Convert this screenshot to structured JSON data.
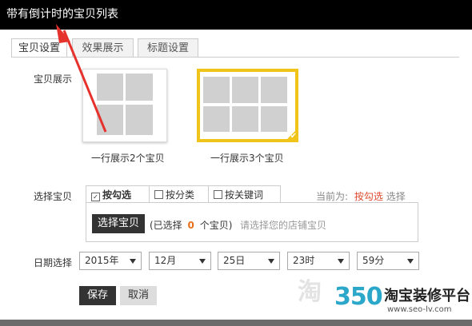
{
  "window": {
    "title": "带有倒计时的宝贝列表"
  },
  "tabs": [
    {
      "label": "宝贝设置",
      "active": true
    },
    {
      "label": "效果展示",
      "active": false
    },
    {
      "label": "标题设置",
      "active": false
    }
  ],
  "display": {
    "label": "宝贝展示",
    "options": [
      {
        "caption": "一行展示2个宝贝",
        "selected": false
      },
      {
        "caption": "一行展示3个宝贝",
        "selected": true
      }
    ]
  },
  "select_items": {
    "label": "选择宝贝",
    "tabs": [
      {
        "label": "按勾选",
        "checked": true
      },
      {
        "label": "按分类",
        "checked": false
      },
      {
        "label": "按关键词",
        "checked": false
      }
    ],
    "current_prefix": "当前为:",
    "current_value": "按勾选",
    "current_suffix": "选择",
    "button_label": "选择宝贝",
    "selected_prefix": "(已选择",
    "selected_count": "0",
    "selected_suffix": "个宝贝)",
    "hint": "请选择您的店铺宝贝"
  },
  "date": {
    "label": "日期选择",
    "year": "2015年",
    "month": "12月",
    "day": "25日",
    "hour": "23时",
    "minute": "59分"
  },
  "actions": {
    "save": "保存",
    "cancel": "取消"
  },
  "watermark": {
    "number": "350",
    "brand": "淘宝装修平台",
    "url": "www.seo-lv.com"
  },
  "colors": {
    "accent": "#f0c419",
    "highlight": "#e04a2f",
    "count": "#e8701a"
  }
}
